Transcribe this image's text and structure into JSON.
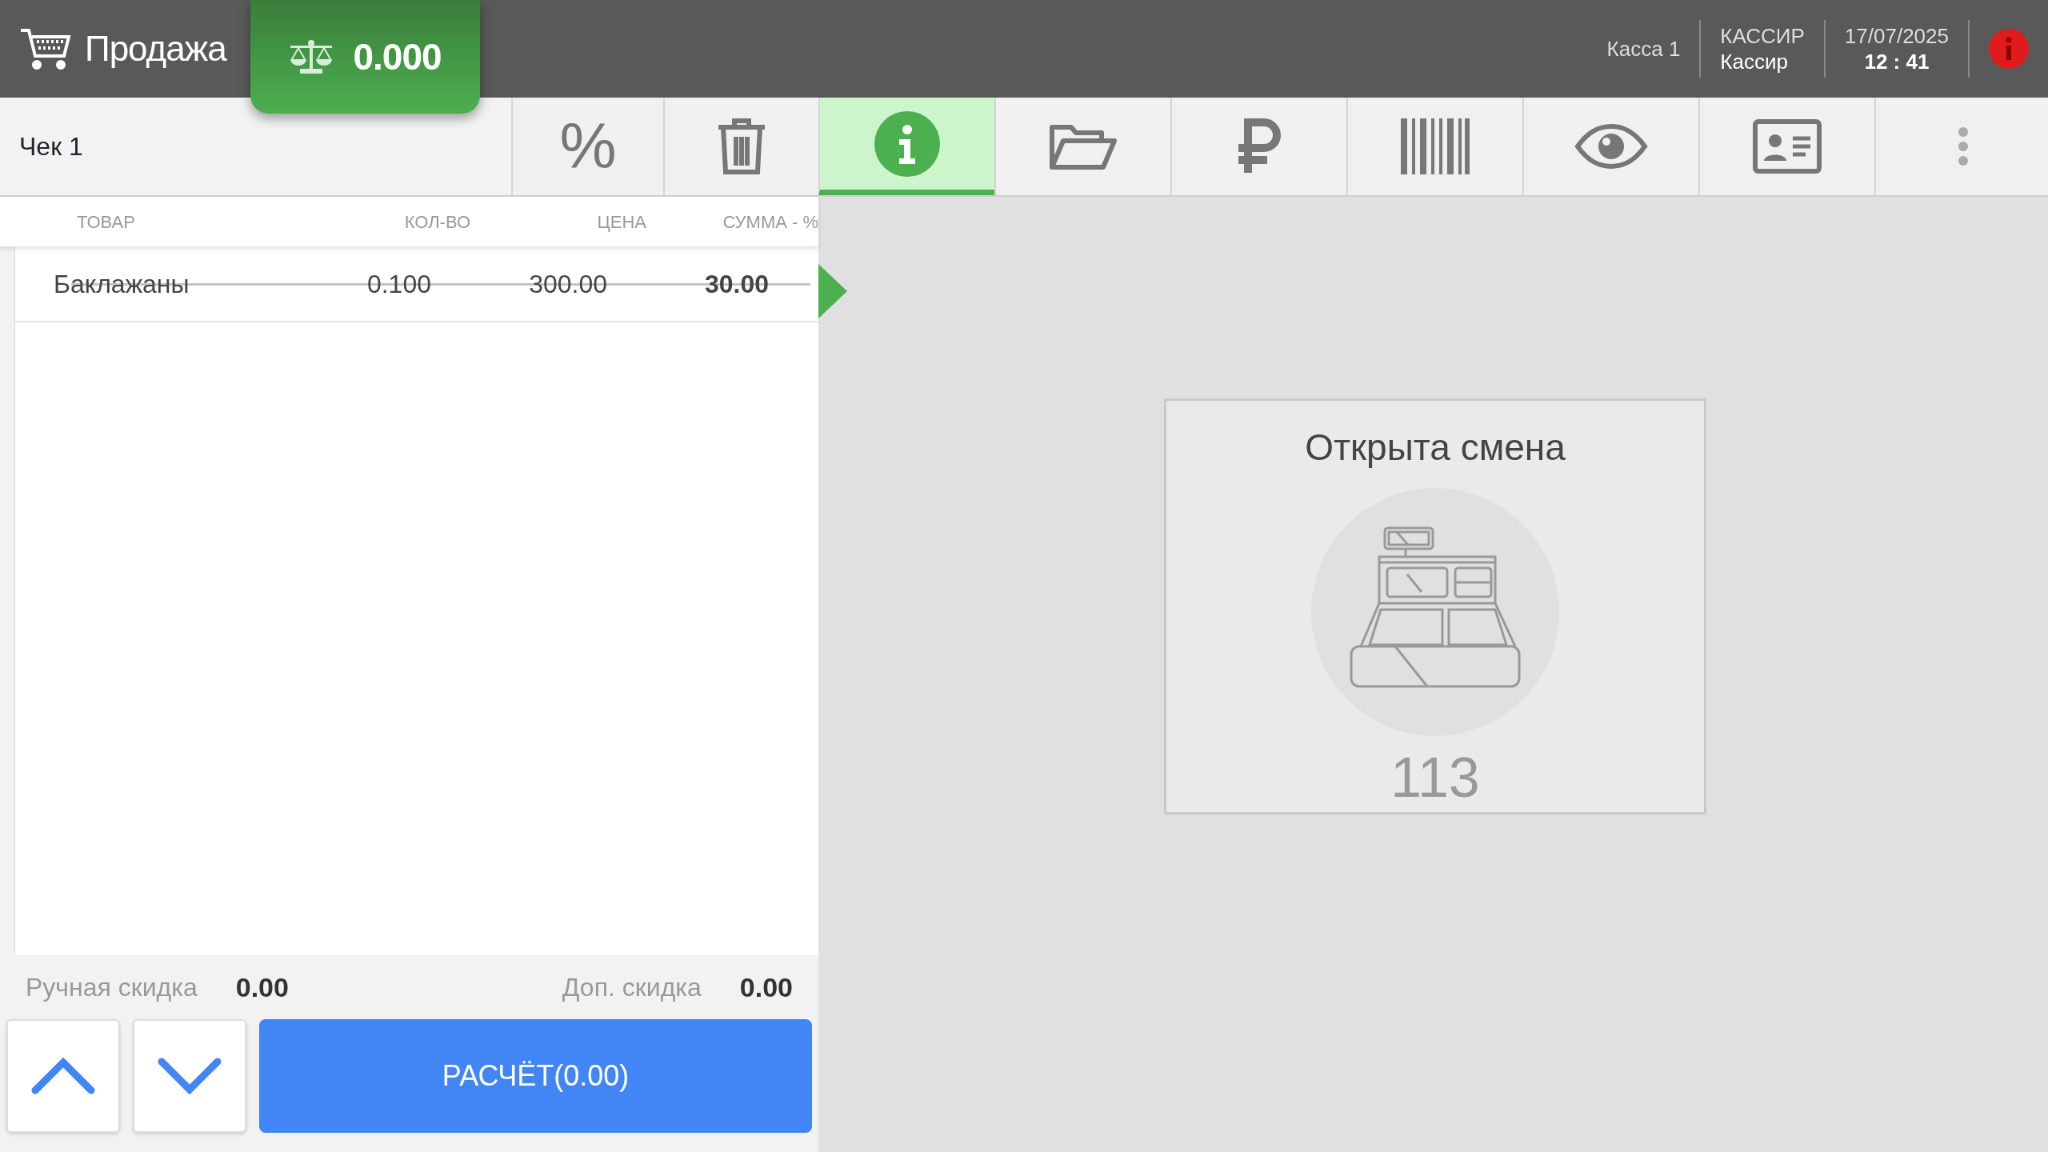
{
  "header": {
    "title": "Продажа",
    "scale_reading": "0.000",
    "register": "Касса 1",
    "role_label": "КАССИР",
    "role": "Кассир",
    "date": "17/07/2025",
    "time": "12 : 41"
  },
  "receipt": {
    "title": "Чек 1",
    "discount_button": "%",
    "columns": [
      "ТОВАР",
      "КОЛ-ВО",
      "ЦЕНА",
      "СУММА - %"
    ],
    "rows": [
      {
        "name": "Баклажаны",
        "qty": "0.100",
        "price": "300.00",
        "sum": "30.00",
        "cancelled": true,
        "selected": true
      }
    ],
    "manual_discount_label": "Ручная скидка",
    "manual_discount": "0.00",
    "extra_discount_label": "Доп. скидка",
    "extra_discount": "0.00",
    "pay_button": "РАСЧЁТ(0.00)"
  },
  "toolbar": [
    {
      "kind": "info",
      "selected": true
    },
    {
      "kind": "folder",
      "selected": false
    },
    {
      "kind": "ruble",
      "selected": false
    },
    {
      "kind": "barcode",
      "selected": false
    },
    {
      "kind": "eye",
      "selected": false
    },
    {
      "kind": "id-card",
      "selected": false
    },
    {
      "kind": "more",
      "selected": false
    }
  ],
  "shift": {
    "title": "Открыта смена",
    "number": "113"
  }
}
